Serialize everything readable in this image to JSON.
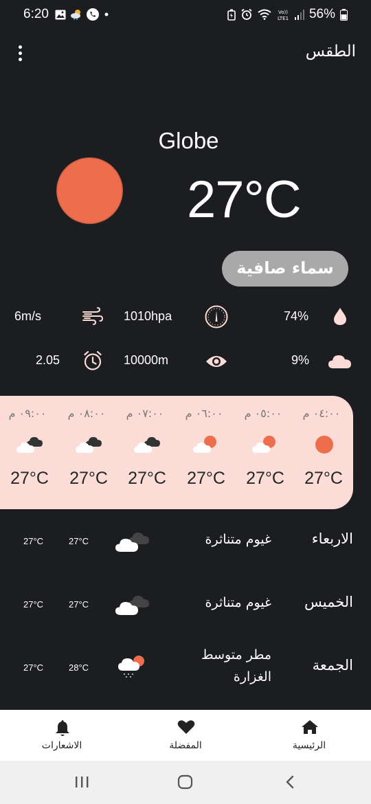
{
  "status_bar": {
    "time": "6:20",
    "battery": "56%",
    "network": "LTE1"
  },
  "header": {
    "title": "الطقس",
    "menu_icon": "more-vertical-icon"
  },
  "current": {
    "city": "Globe",
    "temperature": "27°C",
    "condition": "سماء صافية",
    "condition_icon": "sun-icon",
    "sun_color": "#ec6e4c"
  },
  "stats": {
    "humidity": "74%",
    "pressure": "1010hpa",
    "wind": "6m/s",
    "clouds": "9%",
    "visibility": "10000m",
    "uv": "2.05"
  },
  "hourly": [
    {
      "time": "٠٤:٠٠ م",
      "icon": "sun-icon",
      "temp": "27°C"
    },
    {
      "time": "٠٥:٠٠ م",
      "icon": "partly-cloudy-icon",
      "temp": "27°C"
    },
    {
      "time": "٠٦:٠٠ م",
      "icon": "partly-cloudy-icon",
      "temp": "27°C"
    },
    {
      "time": "٠٧:٠٠ م",
      "icon": "scattered-clouds-icon",
      "temp": "27°C"
    },
    {
      "time": "٠٨:٠٠ م",
      "icon": "scattered-clouds-icon",
      "temp": "27°C"
    },
    {
      "time": "٠٩:٠٠ م",
      "icon": "scattered-clouds-icon",
      "temp": "27°C"
    }
  ],
  "daily": [
    {
      "day": "الاربعاء",
      "condition": "غيوم متناثرة",
      "icon": "scattered-clouds-icon",
      "high": "27°C",
      "low": "27°C"
    },
    {
      "day": "الخميس",
      "condition": "غيوم متناثرة",
      "icon": "scattered-clouds-icon",
      "high": "27°C",
      "low": "27°C"
    },
    {
      "day": "الجمعة",
      "condition_line1": "مطر متوسط",
      "condition_line2": "الغزارة",
      "icon": "rain-icon",
      "high": "28°C",
      "low": "27°C"
    }
  ],
  "bottom_nav": {
    "home": "الرئيسية",
    "favorites": "المفضلة",
    "notifications": "الاشعارات"
  },
  "colors": {
    "background": "#1c1d20",
    "hourly_card": "#fcdcd6",
    "accent_sun": "#ec6e4c",
    "pill": "#a9a9a9"
  }
}
